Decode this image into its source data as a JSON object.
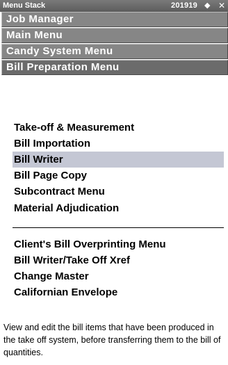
{
  "titlebar": {
    "title": "Menu Stack",
    "code": "201919",
    "back_icon": "left-arrow-icon",
    "close_icon": "close-icon",
    "back_glyph": "✦",
    "close_glyph": "✕"
  },
  "stack": [
    {
      "label": "Job Manager"
    },
    {
      "label": "Main Menu"
    },
    {
      "label": "Candy System Menu"
    },
    {
      "label": "Bill Preparation Menu"
    }
  ],
  "menu_group_1": [
    {
      "label": "Take-off & Measurement"
    },
    {
      "label": "Bill Importation"
    },
    {
      "label": "Bill Writer",
      "selected": true
    },
    {
      "label": "Bill Page Copy"
    },
    {
      "label": "Subcontract Menu"
    },
    {
      "label": "Material Adjudication"
    }
  ],
  "menu_group_2": [
    {
      "label": "Client's Bill Overprinting Menu"
    },
    {
      "label": "Bill Writer/Take Off Xref"
    },
    {
      "label": "Change Master"
    },
    {
      "label": "Californian Envelope"
    }
  ],
  "description": "View and edit the bill items that have been produced in the take off system, before transferring them to the bill of quantities.",
  "colors": {
    "titlebar": "#666666",
    "stack_button": "#868686",
    "selection": "#c4c7d4"
  }
}
